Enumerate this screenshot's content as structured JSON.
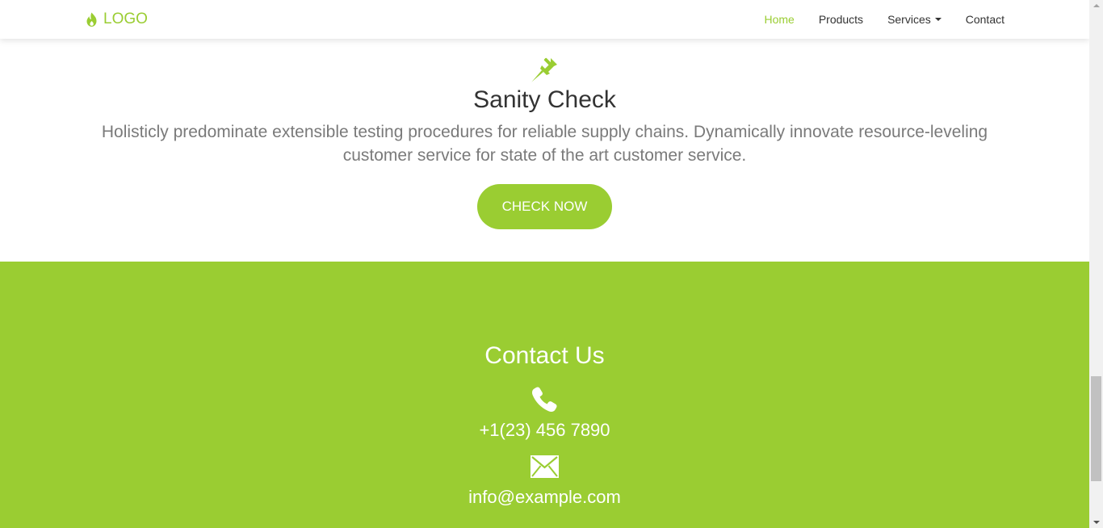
{
  "navbar": {
    "logo_text": "LOGO",
    "logo_icon": "flame-icon",
    "items": [
      {
        "label": "Home",
        "active": true
      },
      {
        "label": "Products",
        "active": false
      },
      {
        "label": "Services",
        "active": false,
        "dropdown": true
      },
      {
        "label": "Contact",
        "active": false
      }
    ]
  },
  "sanity": {
    "icon": "pushpin-icon",
    "title": "Sanity Check",
    "description": "Holisticly predominate extensible testing procedures for reliable supply chains. Dynamically innovate resource-leveling customer service for state of the art customer service.",
    "button_label": "CHECK NOW"
  },
  "contact": {
    "title": "Contact Us",
    "phone_icon": "phone-icon",
    "phone": "+1(23) 456 7890",
    "email_icon": "envelope-icon",
    "email": "info@example.com"
  },
  "colors": {
    "accent": "#9acd32",
    "text_dark": "#333333",
    "text_muted": "#7a7a7a",
    "white": "#ffffff"
  }
}
